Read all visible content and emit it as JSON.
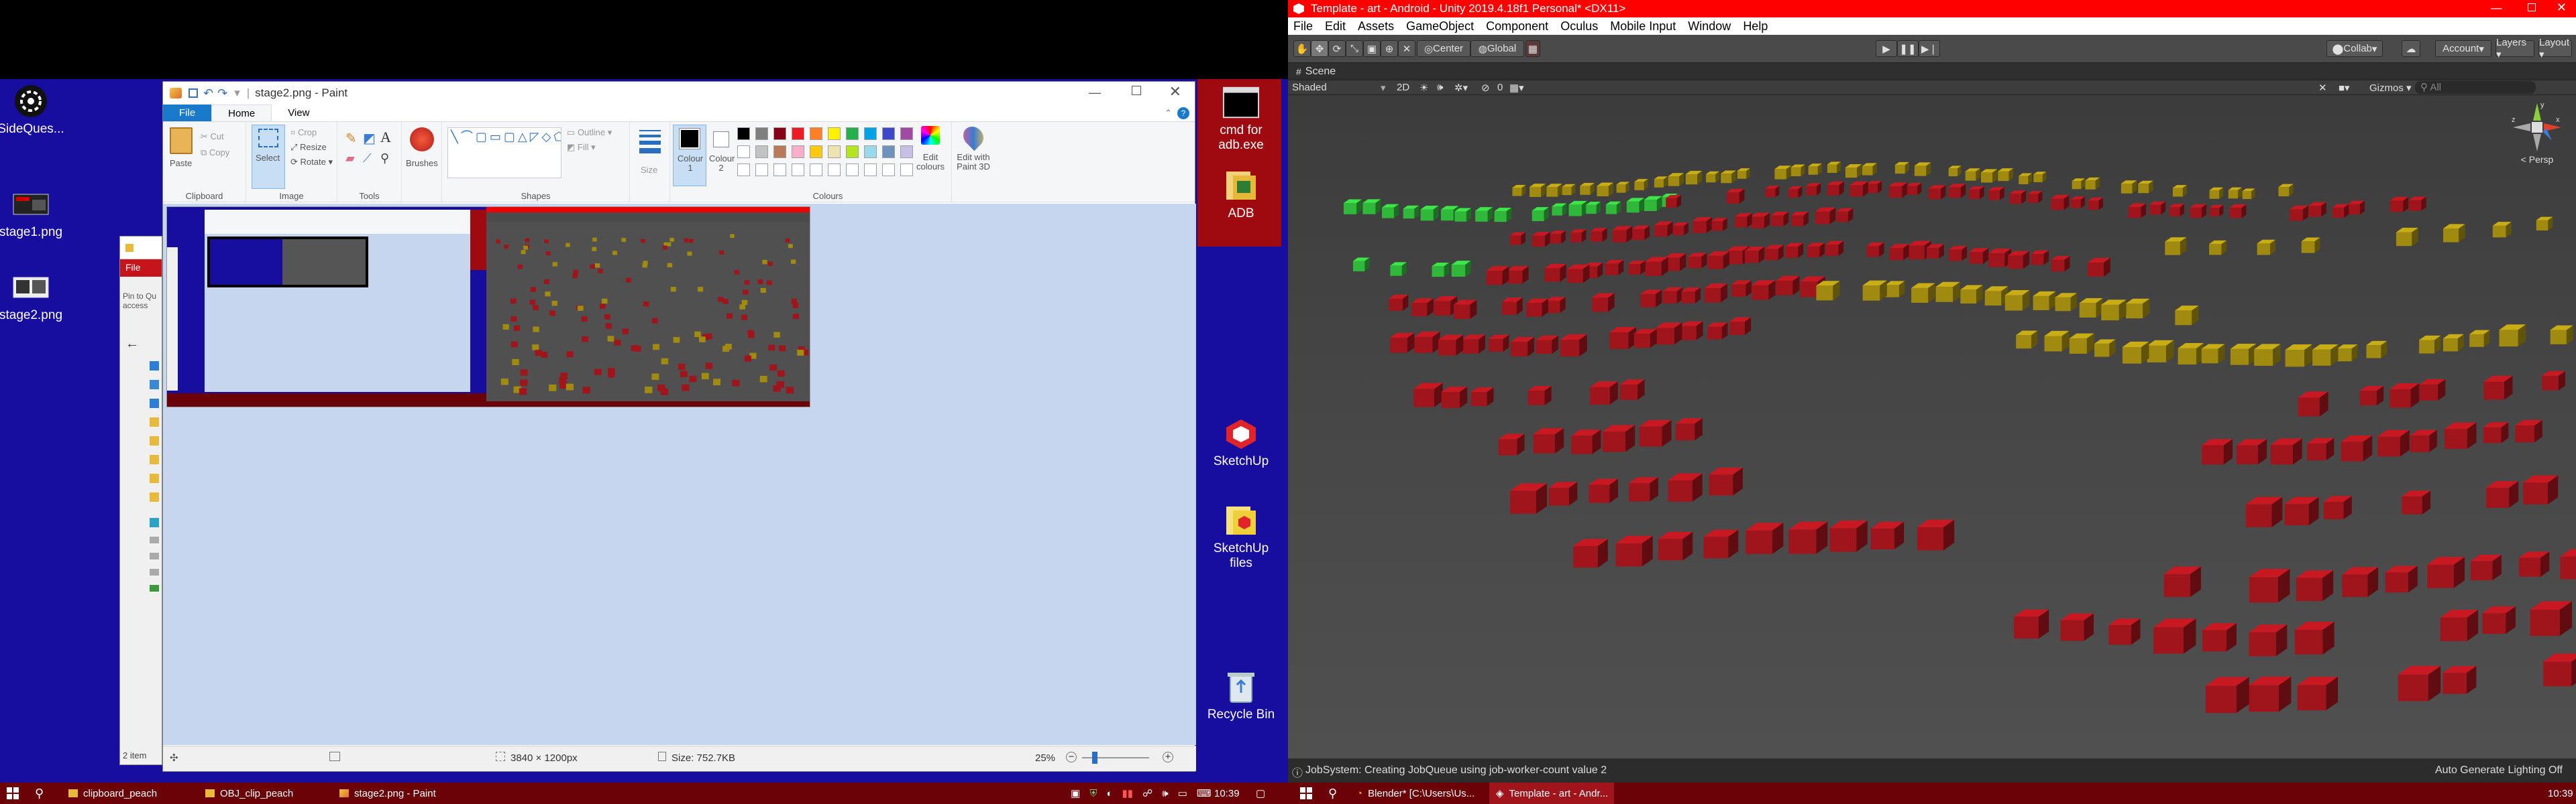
{
  "left_monitor": {
    "desktop_icons": [
      {
        "label": "SideQues...",
        "icon": "sidequest-icon"
      },
      {
        "label": "stage1.png",
        "icon": "image-file-icon"
      },
      {
        "label": "stage2.png",
        "icon": "image-file-icon"
      }
    ],
    "right_desktop_icons": [
      {
        "label": "cmd for adb.exe",
        "icon": "cmd-icon"
      },
      {
        "label": "ADB",
        "icon": "folder-icon"
      },
      {
        "label": "SketchUp",
        "icon": "sketchup-icon"
      },
      {
        "label": "SketchUp files",
        "icon": "folder-icon"
      },
      {
        "label": "Recycle Bin",
        "icon": "recycle-bin-icon"
      }
    ],
    "background_explorer": {
      "file_tab": "File",
      "pin_text": "Pin to Qu access",
      "items_count": "2 item"
    },
    "paint": {
      "title": "stage2.png - Paint",
      "tabs": [
        "File",
        "Home",
        "View"
      ],
      "clipboard": {
        "paste": "Paste",
        "cut": "Cut",
        "copy": "Copy",
        "group": "Clipboard"
      },
      "image": {
        "select": "Select",
        "crop": "Crop",
        "resize": "Resize",
        "rotate": "Rotate",
        "group": "Image"
      },
      "tools": {
        "group": "Tools"
      },
      "brushes": "Brushes",
      "shapes": {
        "outline": "Outline",
        "fill": "Fill",
        "group": "Shapes"
      },
      "size": "Size",
      "colour1": "Colour 1",
      "colour2": "Colour 2",
      "colours_group": "Colours",
      "edit_colours": "Edit colours",
      "edit_paint3d": "Edit with Paint 3D",
      "palette": [
        "#000000",
        "#7f7f7f",
        "#880015",
        "#ed1c24",
        "#ff7f27",
        "#fff200",
        "#22b14c",
        "#00a2e8",
        "#3f48cc",
        "#a349a4",
        "#ffffff",
        "#c3c3c3",
        "#b97a57",
        "#ffaec9",
        "#ffc90e",
        "#efe4b0",
        "#b5e61d",
        "#99d9ea",
        "#7092be",
        "#c8bfe7"
      ],
      "status": {
        "dimensions": "3840 × 1200px",
        "size": "Size: 752.7KB",
        "zoom": "25%"
      }
    },
    "taskbar": {
      "items": [
        "clipboard_peach",
        "OBJ_clip_peach",
        "stage2.png - Paint"
      ],
      "clock": "10:39"
    }
  },
  "unity": {
    "title": "Template - art - Android - Unity 2019.4.18f1 Personal* <DX11>",
    "menu": [
      "File",
      "Edit",
      "Assets",
      "GameObject",
      "Component",
      "Oculus",
      "Mobile Input",
      "Window",
      "Help"
    ],
    "toolbar": {
      "center": "Center",
      "global": "Global",
      "collab": "Collab",
      "account": "Account",
      "layers": "Layers",
      "layout": "Layout"
    },
    "scene_tab": "Scene",
    "scene_bar": {
      "shading": "Shaded",
      "mode": "2D",
      "gizmos": "Gizmos",
      "search": "All",
      "fx_count": "0"
    },
    "persp_label": "Persp",
    "status": {
      "message": "JobSystem: Creating JobQueue using job-worker-count value 2",
      "lighting": "Auto Generate Lighting Off"
    },
    "taskbar": {
      "items": [
        "Blender* [C:\\Users\\Us...",
        "Template - art - Andr..."
      ],
      "clock": "10:39"
    },
    "accent_colors": {
      "green": "#30b83a",
      "red": "#a0141b",
      "yellow": "#a08a10"
    }
  }
}
